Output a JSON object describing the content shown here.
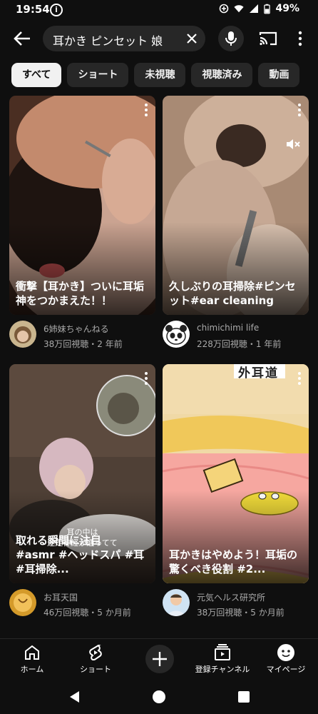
{
  "status_bar": {
    "time": "19:54",
    "battery": "49%"
  },
  "search": {
    "query": "耳かき ピンセット 娘"
  },
  "chips": [
    "すべて",
    "ショート",
    "未視聴",
    "視聴済み",
    "動画"
  ],
  "videos": [
    {
      "title": "衝撃【耳かき】ついに耳垢神をつかまえた！！",
      "channel": "6姉妹ちゃんねる",
      "stats": "38万回視聴・2 年前"
    },
    {
      "title": "久しぶりの耳掃除#ピンセット#ear cleaning",
      "channel": "chimichimi life",
      "stats": "228万回視聴・1 年前"
    },
    {
      "title": "取れる瞬間に注目　#asmr #ヘッドスパ #耳 #耳掃除...",
      "channel": "お耳天国",
      "stats": "46万回視聴・5 か月前",
      "caption_line1": "耳の中は",
      "caption_line2": "迷走神経が通ってて"
    },
    {
      "title": "耳かきはやめよう！耳垢の驚くべき役割 #2...",
      "channel": "元気ヘルス研究所",
      "stats": "38万回視聴・5 か月前",
      "label": "外耳道"
    }
  ],
  "bottom_nav": [
    "ホーム",
    "ショート",
    "登録チャンネル",
    "マイページ"
  ]
}
